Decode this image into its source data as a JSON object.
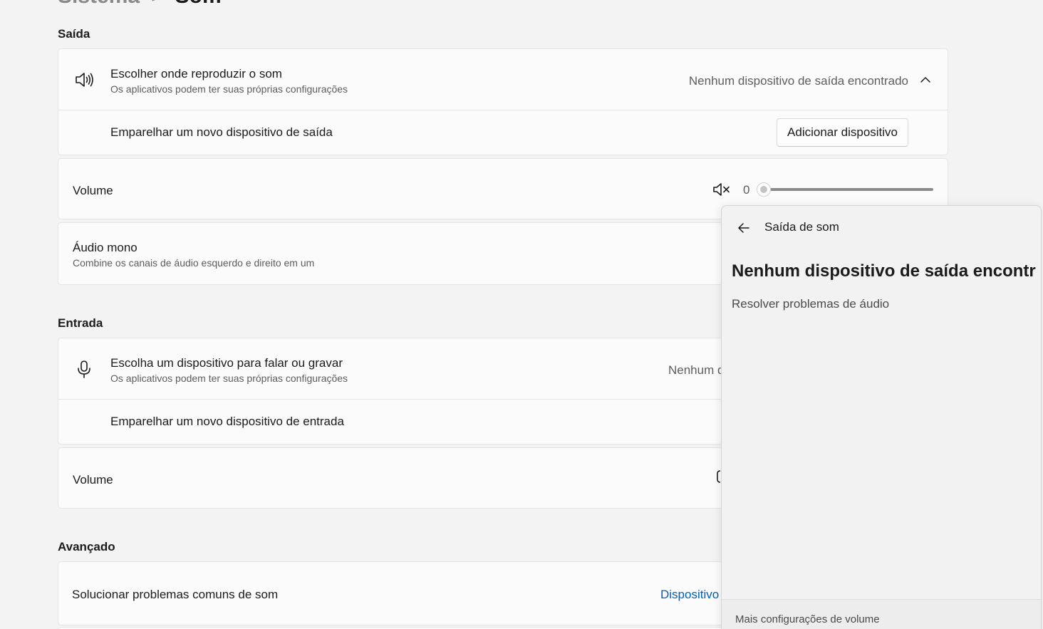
{
  "breadcrumb": {
    "parent": "Sistema",
    "separator": ">",
    "current": "Som"
  },
  "sections": {
    "output": "Saída",
    "input": "Entrada",
    "advanced": "Avançado"
  },
  "output": {
    "choose": {
      "title": "Escolher onde reproduzir o som",
      "subtitle": "Os aplicativos podem ter suas próprias configurações",
      "value": "Nenhum dispositivo de saída encontrado"
    },
    "pair": {
      "title": "Emparelhar um novo dispositivo de saída",
      "button": "Adicionar dispositivo"
    },
    "volume": {
      "title": "Volume",
      "value": "0",
      "level": 0
    },
    "mono": {
      "title": "Áudio mono",
      "subtitle": "Combine os canais de áudio esquerdo e direito em um"
    }
  },
  "input": {
    "choose": {
      "title": "Escolha um dispositivo para falar ou gravar",
      "subtitle": "Os aplicativos podem ter suas próprias configurações",
      "value": "Nenhum d"
    },
    "pair": {
      "title": "Emparelhar um novo dispositivo de entrada"
    },
    "volume": {
      "title": "Volume"
    }
  },
  "advanced": {
    "troubleshoot": {
      "title": "Solucionar problemas comuns de som",
      "link": "Dispositivo"
    }
  },
  "flyout": {
    "header": "Saída de som",
    "heading": "Nenhum dispositivo de saída encontr",
    "troubleshoot": "Resolver problemas de áudio",
    "footer": "Mais configurações de volume"
  },
  "colors": {
    "accent": "#005fb8",
    "background": "#f3f3f3",
    "card": "#fbfbfb"
  },
  "icons": [
    "speaker-icon",
    "chevron-up-icon",
    "speaker-muted-icon",
    "microphone-icon",
    "back-arrow-icon"
  ]
}
